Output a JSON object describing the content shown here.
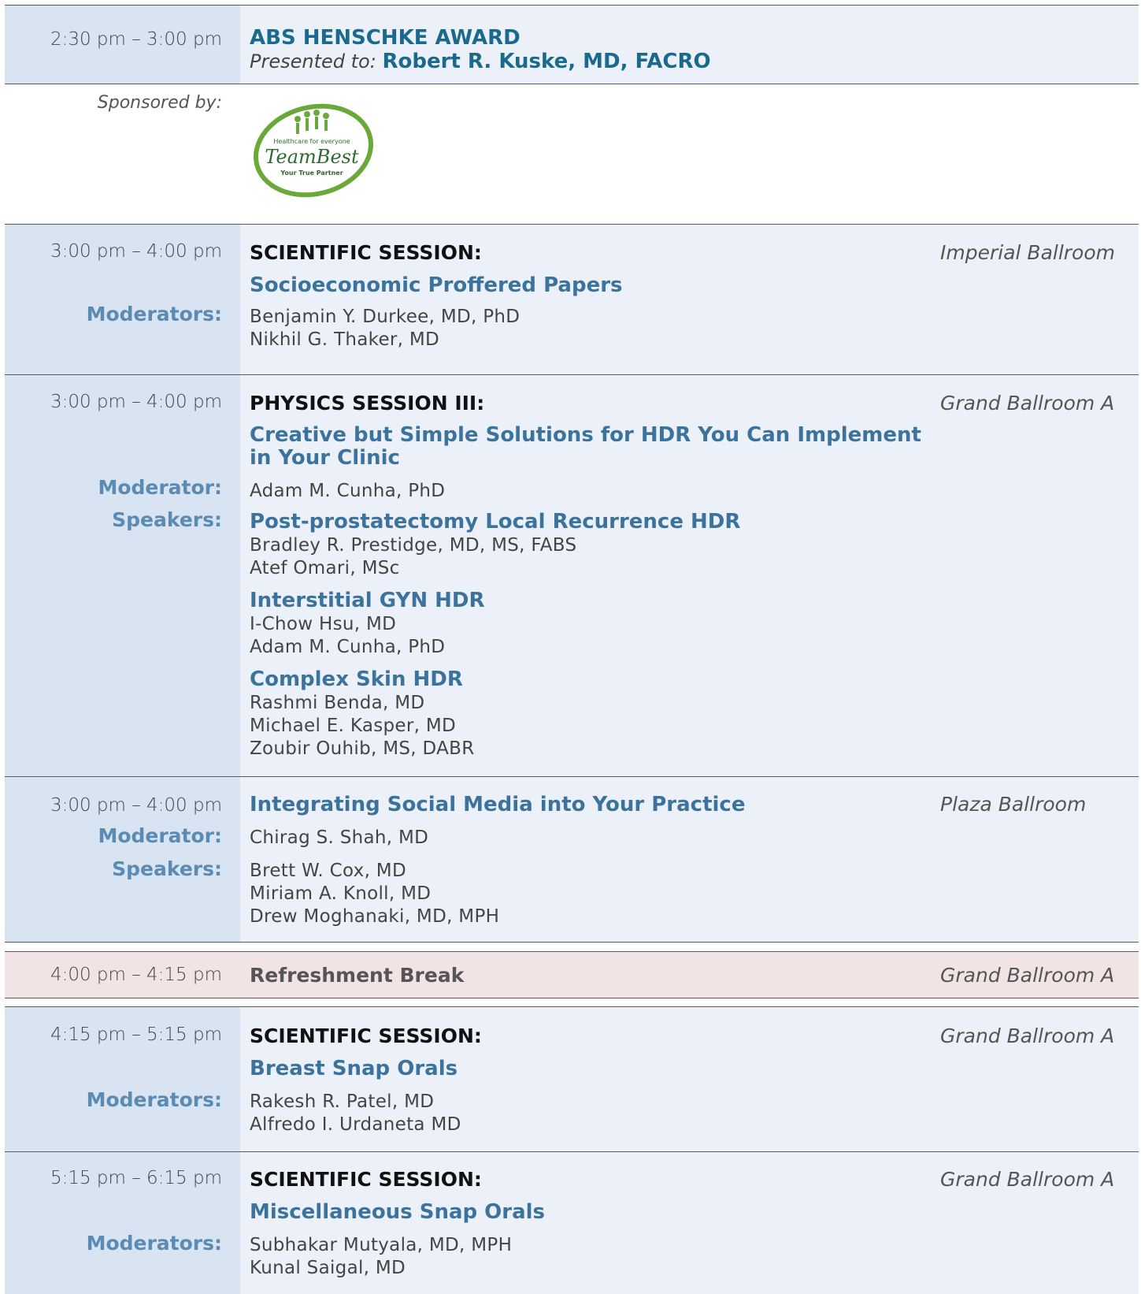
{
  "award": {
    "time": "2:30 pm – 3:00 pm",
    "title": "ABS HENSCHKE AWARD",
    "presented_label": "Presented to:",
    "presented_name": "Robert R. Kuske, MD, FACRO"
  },
  "sponsor": {
    "label": "Sponsored by:",
    "logo_icon": "teambest-logo",
    "logo_tagline": "Healthcare for everyone",
    "logo_name": "TeamBest",
    "logo_subtitle": "Your True Partner"
  },
  "s1": {
    "time": "3:00 pm – 4:00 pm",
    "header": "SCIENTIFIC SESSION:",
    "title": "Socioeconomic Proffered Papers",
    "location": "Imperial Ballroom",
    "role": "Moderators:",
    "people": [
      "Benjamin Y. Durkee, MD, PhD",
      "Nikhil G. Thaker, MD"
    ]
  },
  "s2": {
    "time": "3:00 pm – 4:00 pm",
    "header": "PHYSICS SESSION III:",
    "title_lines": [
      "Creative but Simple Solutions for HDR You Can Implement",
      "in Your Clinic"
    ],
    "location": "Grand Ballroom A",
    "moderator_role": "Moderator:",
    "moderator": "Adam M. Cunha, PhD",
    "speakers_role": "Speakers:",
    "talks": [
      {
        "title": "Post-prostatectomy Local Recurrence HDR",
        "people": [
          "Bradley R. Prestidge, MD, MS, FABS",
          "Atef Omari, MSc"
        ]
      },
      {
        "title": "Interstitial GYN HDR",
        "people": [
          "I-Chow Hsu, MD",
          "Adam M. Cunha, PhD"
        ]
      },
      {
        "title": "Complex Skin HDR",
        "people": [
          "Rashmi Benda, MD",
          "Michael E. Kasper, MD",
          "Zoubir Ouhib, MS, DABR"
        ]
      }
    ]
  },
  "s3": {
    "time": "3:00 pm – 4:00 pm",
    "title": "Integrating Social Media into Your Practice",
    "location": "Plaza Ballroom",
    "moderator_role": "Moderator:",
    "moderator": "Chirag S. Shah, MD",
    "speakers_role": "Speakers:",
    "speakers": [
      "Brett W. Cox, MD",
      "Miriam A. Knoll, MD",
      "Drew Moghanaki, MD, MPH"
    ]
  },
  "brk": {
    "time": "4:00 pm – 4:15 pm",
    "title": "Refreshment Break",
    "location": "Grand Ballroom A"
  },
  "s4": {
    "time": "4:15 pm – 5:15 pm",
    "header": "SCIENTIFIC SESSION:",
    "title": "Breast Snap Orals",
    "location": "Grand Ballroom A",
    "role": "Moderators:",
    "people": [
      "Rakesh R. Patel, MD",
      "Alfredo I. Urdaneta MD"
    ]
  },
  "s5": {
    "time": "5:15 pm – 6:15 pm",
    "header": "SCIENTIFIC SESSION:",
    "title": "Miscellaneous Snap Orals",
    "location": "Grand Ballroom A",
    "role": "Moderators:",
    "people": [
      "Subhakar Mutyala, MD, MPH",
      "Kunal Saigal, MD"
    ]
  }
}
